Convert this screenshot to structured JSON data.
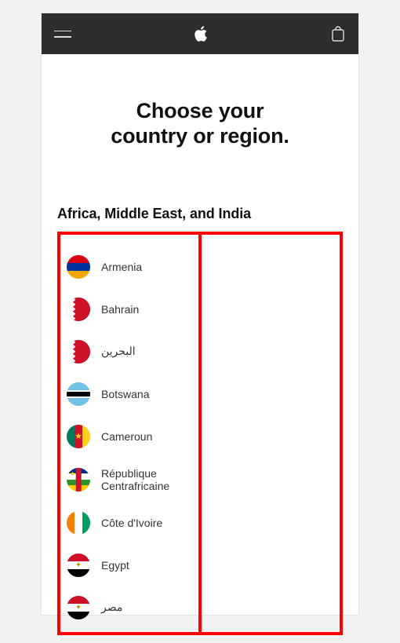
{
  "title_line1": "Choose your",
  "title_line2": "country or region.",
  "section_heading": "Africa, Middle East, and India",
  "countries_col1": [
    {
      "key": "armenia",
      "label": "Armenia",
      "flag": "armenia"
    },
    {
      "key": "bahrain",
      "label": "Bahrain",
      "flag": "bahrain"
    },
    {
      "key": "bahrain_ar",
      "label": "البحرين",
      "flag": "bahrain"
    },
    {
      "key": "botswana",
      "label": "Botswana",
      "flag": "botswana"
    },
    {
      "key": "cameroun",
      "label": "Cameroun",
      "flag": "cameroon"
    },
    {
      "key": "car",
      "label": "République Centrafricaine",
      "flag": "car"
    },
    {
      "key": "civ",
      "label": "Côte d'Ivoire",
      "flag": "civ"
    },
    {
      "key": "egypt",
      "label": "Egypt",
      "flag": "egypt"
    },
    {
      "key": "egypt_ar",
      "label": "مصر",
      "flag": "egypt"
    }
  ],
  "countries_col2": []
}
